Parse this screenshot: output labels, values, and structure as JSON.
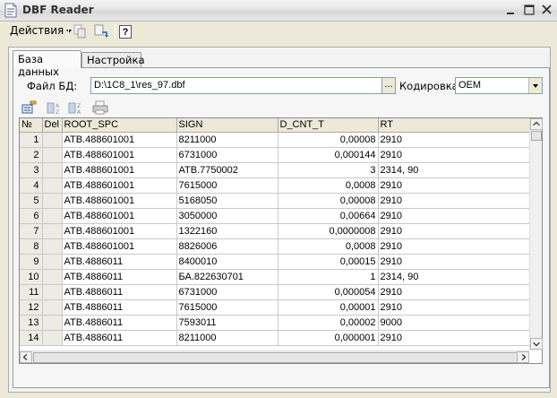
{
  "window": {
    "title": "DBF Reader",
    "app_icon": "document-icon",
    "buttons": [
      "minimize-icon",
      "maximize-icon",
      "close-icon"
    ]
  },
  "toolbar": {
    "actions_label": "Действия",
    "help_label": "?"
  },
  "tabs": [
    {
      "label": "База данных",
      "active": true
    },
    {
      "label": "Настройка",
      "active": false
    }
  ],
  "form": {
    "file_label": "Файл БД:",
    "file_value": "D:\\1C8_1\\res_97.dbf",
    "browse_label": "...",
    "encoding_label": "Кодировка:",
    "encoding_value": "OEM"
  },
  "table": {
    "columns": [
      "№",
      "Del",
      "ROOT_SPC",
      "SIGN",
      "D_CNT_T",
      "RT"
    ],
    "rows": [
      [
        "1",
        "",
        "АТВ.488601001",
        "8211000",
        "0,00008",
        "2910"
      ],
      [
        "2",
        "",
        "АТВ.488601001",
        "6731000",
        "0,000144",
        "2910"
      ],
      [
        "3",
        "",
        "АТВ.488601001",
        "АТВ.7750002",
        "3",
        "2314, 90"
      ],
      [
        "4",
        "",
        "АТВ.488601001",
        "7615000",
        "0,0008",
        "2910"
      ],
      [
        "5",
        "",
        "АТВ.488601001",
        "5168050",
        "0,00008",
        "2910"
      ],
      [
        "6",
        "",
        "АТВ.488601001",
        "3050000",
        "0,00664",
        "2910"
      ],
      [
        "7",
        "",
        "АТВ.488601001",
        "1322160",
        "0,0000008",
        "2910"
      ],
      [
        "8",
        "",
        "АТВ.488601001",
        "8826006",
        "0,0008",
        "2910"
      ],
      [
        "9",
        "",
        "АТВ.4886011",
        "8400010",
        "0,00015",
        "2910"
      ],
      [
        "10",
        "",
        "АТВ.4886011",
        "БА.822630701",
        "1",
        "2314, 90"
      ],
      [
        "11",
        "",
        "АТВ.4886011",
        "6731000",
        "0,000054",
        "2910"
      ],
      [
        "12",
        "",
        "АТВ.4886011",
        "7615000",
        "0,00001",
        "2910"
      ],
      [
        "13",
        "",
        "АТВ.4886011",
        "7593011",
        "0,00002",
        "9000"
      ],
      [
        "14",
        "",
        "АТВ.4886011",
        "8211000",
        "0,000001",
        "2910"
      ]
    ]
  }
}
